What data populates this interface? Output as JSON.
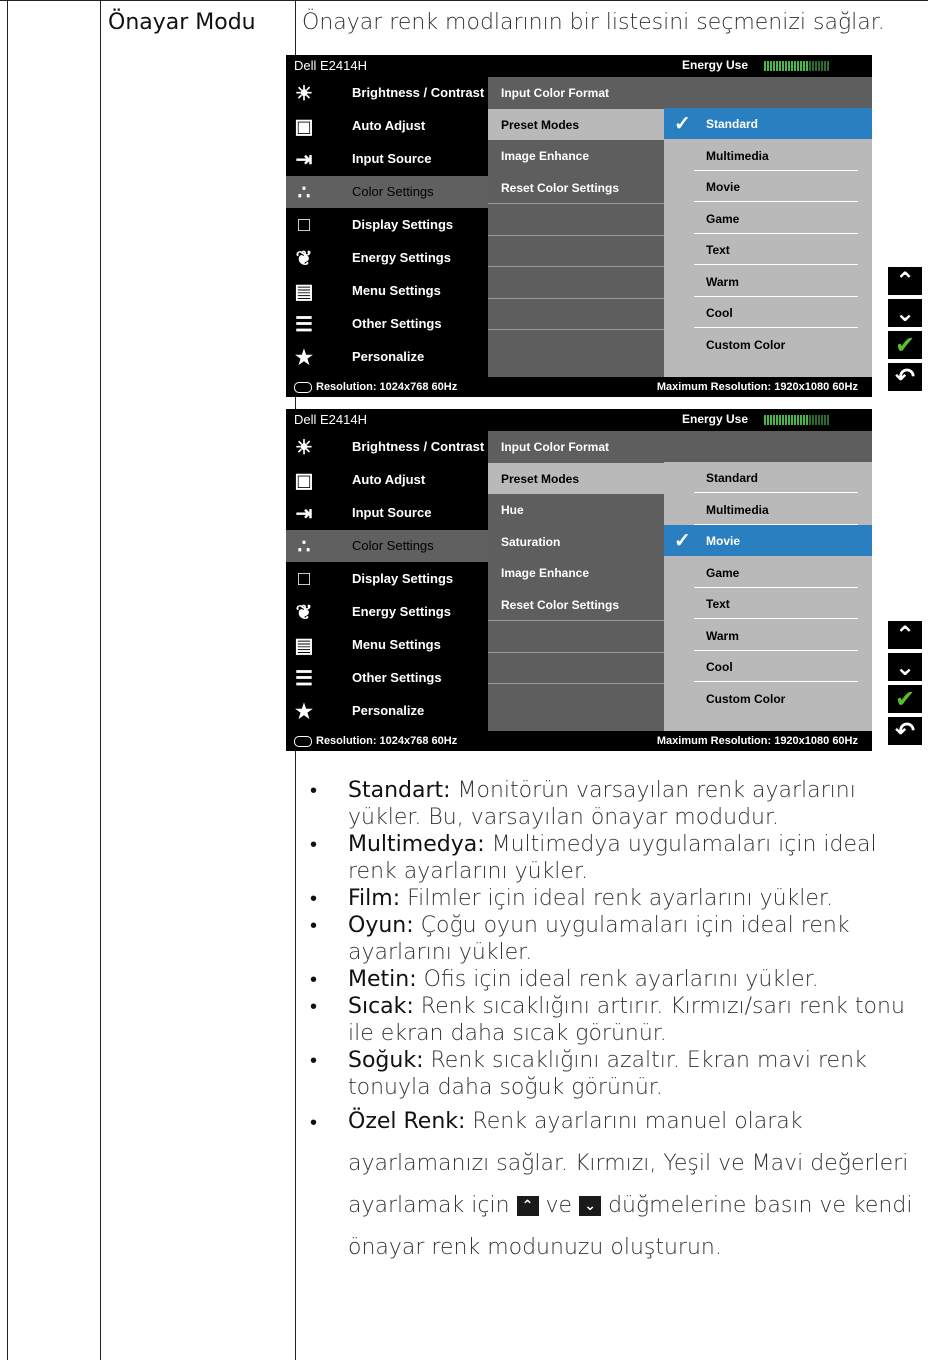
{
  "heading": "Önayar Modu",
  "intro": "Önayar renk modlarının bir listesini seçmenizi sağlar.",
  "osd": {
    "model": "Dell E2414H",
    "energy_label": "Energy Use",
    "menu": [
      "Brightness / Contrast",
      "Auto Adjust",
      "Input Source",
      "Color Settings",
      "Display Settings",
      "Energy Settings",
      "Menu Settings",
      "Other Settings",
      "Personalize"
    ],
    "resolution": "Resolution:  1024x768 60Hz",
    "max_resolution": "Maximum Resolution: 1920x1080 60Hz",
    "options": [
      "Standard",
      "Multimedia",
      "Movie",
      "Game",
      "Text",
      "Warm",
      "Cool",
      "Custom Color"
    ],
    "screen1": {
      "header": "Input Color Format",
      "submenu": [
        "Preset Modes",
        "Image Enhance",
        "Reset Color Settings"
      ],
      "selected_option": "Standard"
    },
    "screen2": {
      "header": "Input Color Format",
      "submenu": [
        "Preset Modes",
        "Hue",
        "Saturation",
        "Image Enhance",
        "Reset Color Settings"
      ],
      "selected_option": "Movie"
    }
  },
  "bullets": [
    {
      "term": "Standart:",
      "text": " Monitörün varsayılan renk ayarlarını yükler. Bu, varsayılan önayar modudur."
    },
    {
      "term": "Multimedya:",
      "text": " Multimedya uygulamaları için ideal renk ayarlarını yükler."
    },
    {
      "term": "Film:",
      "text": " Filmler için ideal renk ayarlarını yükler."
    },
    {
      "term": "Oyun:",
      "text": " Çoğu oyun uygulamaları için ideal renk ayarlarını yükler."
    },
    {
      "term": "Metin:",
      "text": " Ofis için ideal renk ayarlarını yükler."
    },
    {
      "term": "Sıcak:",
      "text": " Renk sıcaklığını artırır. Kırmızı/sarı renk tonu ile ekran daha sıcak görünür."
    },
    {
      "term": "Soğuk:",
      "text": " Renk sıcaklığını azaltır. Ekran mavi renk tonuyla daha soğuk görünür."
    }
  ],
  "custom": {
    "term": "Özel Renk:",
    "text_a": " Renk ayarlarını manuel olarak ayarlamanızı sağlar. Kırmızı, Yeşil ve Mavi değerleri ayarlamak için ",
    "text_ve": " ve ",
    "text_b": " düğmelerine basın ve kendi önayar renk modunuzu oluşturun."
  }
}
